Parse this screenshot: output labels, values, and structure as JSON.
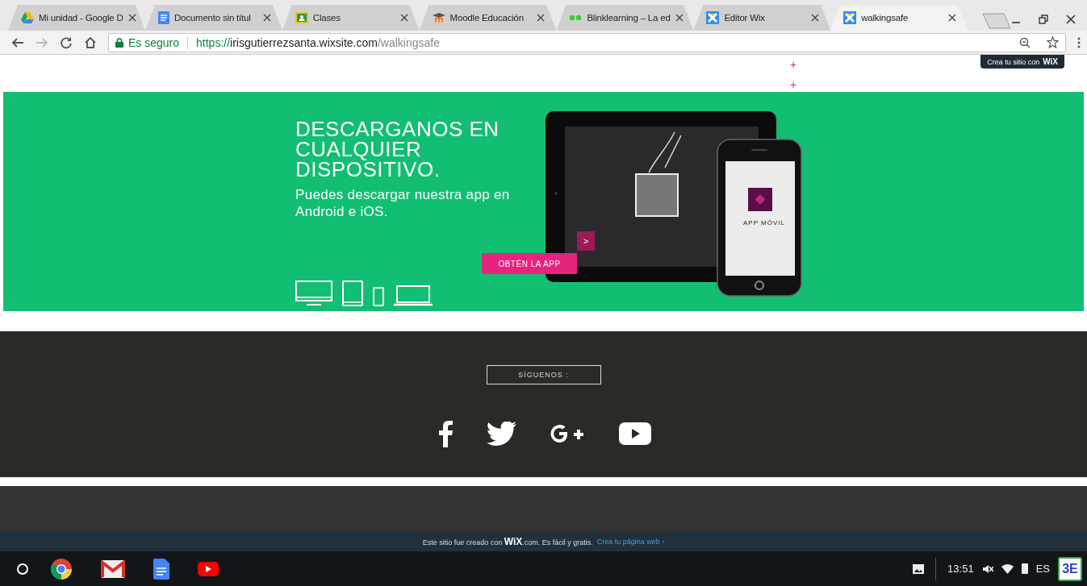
{
  "tabs": [
    {
      "kind": "drive",
      "title": "Mi unidad - Google D",
      "selected": false
    },
    {
      "kind": "docs",
      "title": "Documento sin títul",
      "selected": false
    },
    {
      "kind": "classroom",
      "title": "Clases",
      "selected": false
    },
    {
      "kind": "moodle",
      "title": "Moodle Educación",
      "selected": false
    },
    {
      "kind": "blink",
      "title": "Blinklearning – La ed",
      "selected": false
    },
    {
      "kind": "wix",
      "title": "Editor Wix",
      "selected": false
    },
    {
      "kind": "wix",
      "title": "walkingsafe",
      "selected": true
    }
  ],
  "toolbar": {
    "back_disabled": false,
    "forward_disabled": true,
    "security_label": "Es seguro",
    "url_scheme": "https://",
    "url_host": "irisgutierrezsanta.wixsite.com",
    "url_path": "/walkingsafe"
  },
  "page": {
    "plus_marks": [
      "+",
      "+"
    ],
    "wix_badge": {
      "text": "Crea tu sitio con",
      "brand": "WiX"
    },
    "hero": {
      "title": "DESCARGANOS EN CUALQUIER DISPOSITIVO.",
      "subtitle": "Puedes descargar nuestra app en Android e iOS.",
      "slide_arrow": ">",
      "phone_label": "APP MÓVIL",
      "button": "OBTÉN LA APP",
      "devices": [
        {
          "kind": "monitor"
        },
        {
          "kind": "tablet"
        },
        {
          "kind": "phone"
        },
        {
          "kind": "laptop"
        }
      ]
    },
    "follow": {
      "label": "SÍGUENOS :",
      "socials": [
        {
          "kind": "facebook"
        },
        {
          "kind": "twitter"
        },
        {
          "kind": "googleplus"
        },
        {
          "kind": "youtube"
        }
      ]
    },
    "wix_footer": {
      "text_before": "Este sitio fue creado con",
      "brand": "WiX",
      "text_after": ".com. Es fácil y gratis.",
      "link": "Crea tu página web ›"
    }
  },
  "shelf": {
    "apps": [
      {
        "kind": "chrome"
      },
      {
        "kind": "gmail"
      },
      {
        "kind": "docs"
      },
      {
        "kind": "youtube"
      }
    ],
    "time": "13:51",
    "language": "ES",
    "avatar": "3E"
  }
}
